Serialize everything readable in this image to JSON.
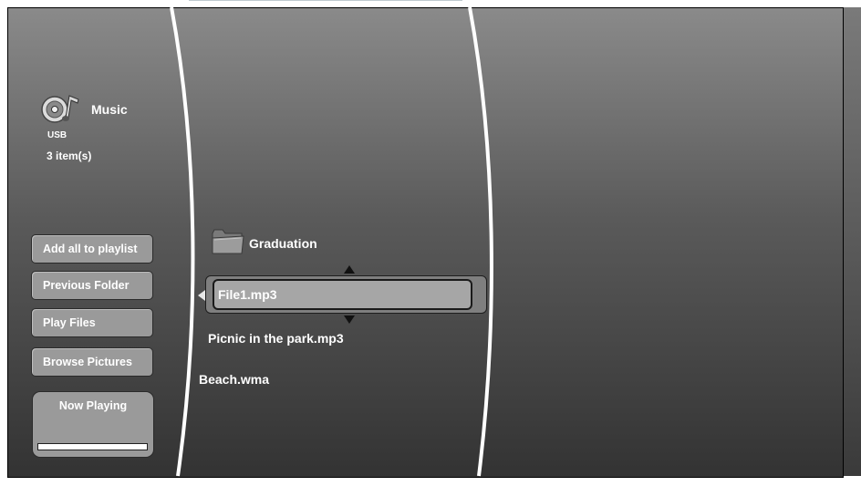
{
  "header": {
    "title": "Music",
    "source": "USB",
    "item_count": "3 item(s)",
    "icon": "music-disc-icon"
  },
  "sidebar": {
    "buttons": [
      {
        "label": "Add all to playlist"
      },
      {
        "label": "Previous Folder"
      },
      {
        "label": "Play Files"
      },
      {
        "label": "Browse Pictures"
      }
    ],
    "now_playing": {
      "label": "Now Playing",
      "progress": 1.0
    }
  },
  "file_list": {
    "folder": {
      "label": "Graduation",
      "icon": "folder-icon"
    },
    "items": [
      {
        "label": "File1.mp3",
        "selected": true
      },
      {
        "label": "Picnic in the park.mp3",
        "selected": false
      },
      {
        "label": "Beach.wma",
        "selected": false
      }
    ]
  },
  "colors": {
    "text": "#ffffff",
    "button_fill": "#9a9a9a",
    "selection_fill": "#a6a6a6",
    "curve_lines": "#ffffff"
  }
}
